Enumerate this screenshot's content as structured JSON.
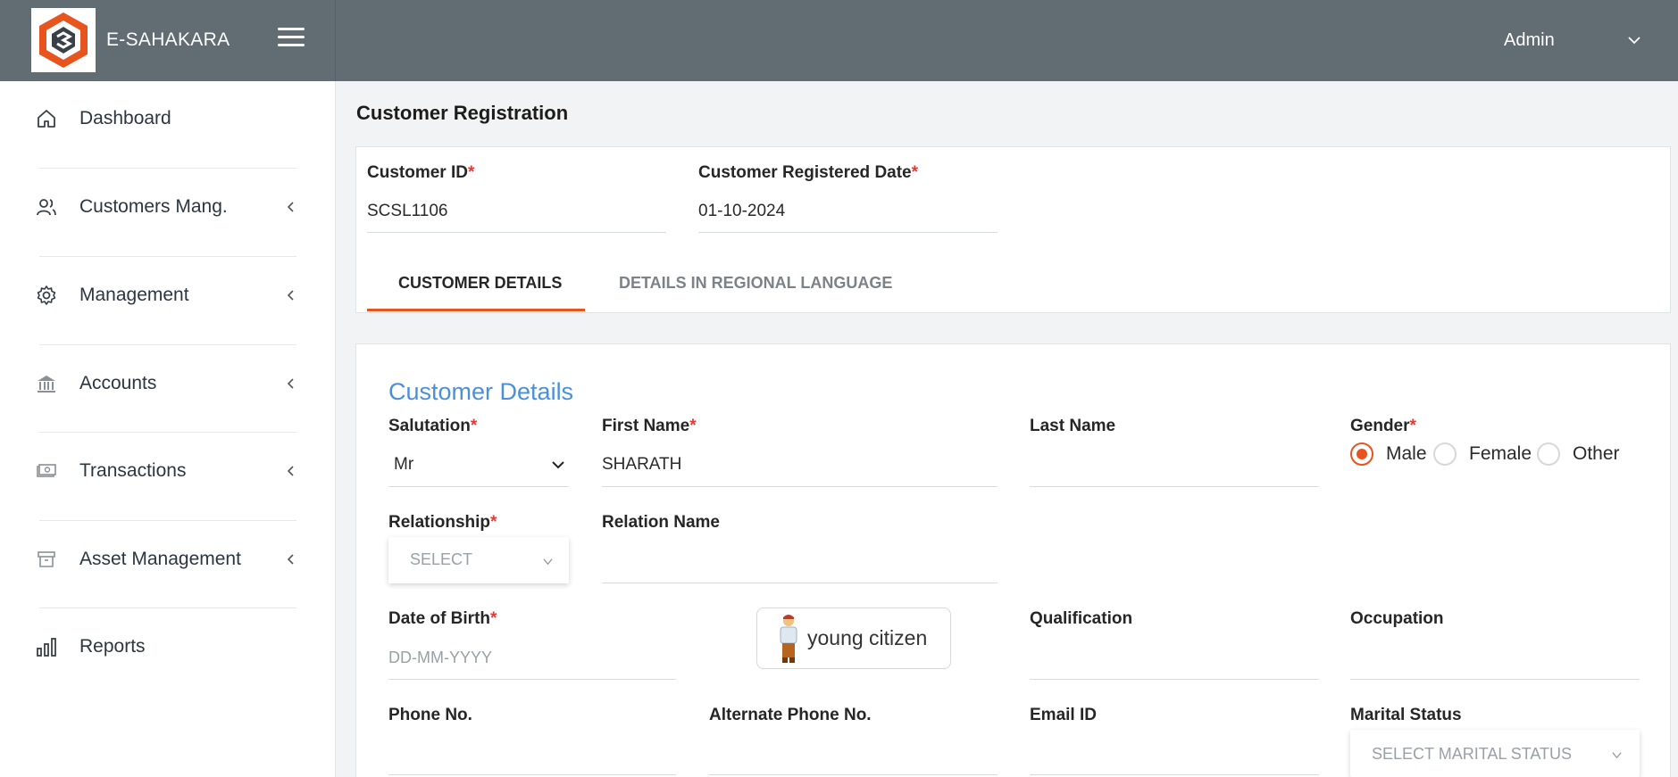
{
  "app": {
    "name": "E-SAHAKARA",
    "user": "Admin"
  },
  "sidebar": {
    "items": [
      {
        "label": "Dashboard",
        "icon": "home-icon"
      },
      {
        "label": "Customers Mang.",
        "icon": "users-icon"
      },
      {
        "label": "Management",
        "icon": "gear-icon"
      },
      {
        "label": "Accounts",
        "icon": "bank-icon"
      },
      {
        "label": "Transactions",
        "icon": "cash-icon"
      },
      {
        "label": "Asset Management",
        "icon": "archive-icon"
      },
      {
        "label": "Reports",
        "icon": "bar-chart-icon"
      }
    ]
  },
  "page": {
    "title": "Customer Registration",
    "customer_id": {
      "label": "Customer ID",
      "value": "SCSL1106"
    },
    "registered_date": {
      "label": "Customer Registered Date",
      "value": "01-10-2024"
    },
    "tabs": [
      {
        "label": "CUSTOMER DETAILS"
      },
      {
        "label": "DETAILS IN REGIONAL LANGUAGE"
      }
    ]
  },
  "form": {
    "section_title": "Customer Details",
    "salutation": {
      "label": "Salutation",
      "value": "Mr"
    },
    "first_name": {
      "label": "First Name",
      "value": "SHARATH"
    },
    "last_name": {
      "label": "Last Name",
      "value": ""
    },
    "gender": {
      "label": "Gender",
      "options": [
        "Male",
        "Female",
        "Other"
      ],
      "selected": "Male"
    },
    "relationship": {
      "label": "Relationship",
      "placeholder": "SELECT"
    },
    "relation_name": {
      "label": "Relation Name",
      "value": ""
    },
    "dob": {
      "label": "Date of Birth",
      "placeholder": "DD-MM-YYYY"
    },
    "badge": {
      "text": "young citizen"
    },
    "qualification": {
      "label": "Qualification",
      "value": ""
    },
    "occupation": {
      "label": "Occupation",
      "value": ""
    },
    "phone": {
      "label": "Phone No.",
      "value": ""
    },
    "alt_phone": {
      "label": "Alternate Phone No.",
      "value": ""
    },
    "email": {
      "label": "Email ID",
      "value": ""
    },
    "marital_status": {
      "label": "Marital Status",
      "placeholder": "SELECT MARITAL STATUS"
    }
  },
  "colors": {
    "topbar": "#626c73",
    "accent": "#e8541e",
    "section_title": "#4a90d9",
    "required": "#e53935"
  }
}
